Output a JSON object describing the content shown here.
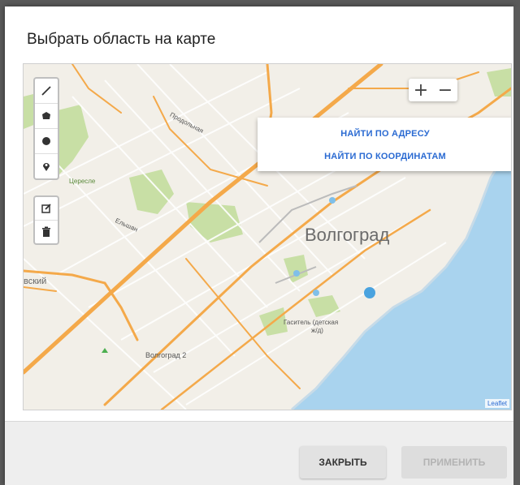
{
  "dialog": {
    "title": "Выбрать область на карте"
  },
  "map": {
    "city_label": "Волгоград",
    "labels": {
      "prodolnaya": "Продольная",
      "elshan": "Ельшан",
      "zelenyi": "Цересле",
      "volgograd2": "Волгоград 2",
      "gasitel": "Гаситель (детская",
      "gasitel2": "ж/д)",
      "vskiy": "вский"
    },
    "attribution": "Leaflet",
    "zoom": {
      "in": "+",
      "out": "−"
    },
    "draw_tools": [
      "polyline-icon",
      "polygon-icon",
      "circle-icon",
      "marker-icon"
    ],
    "edit_tools": [
      "edit-icon",
      "delete-icon"
    ],
    "colors": {
      "water": "#a9d3ee",
      "land": "#f2efe8",
      "park": "#c8dfa5",
      "road": "#f4a94a"
    }
  },
  "search_panel": {
    "find_by_address": "НАЙТИ ПО АДРЕСУ",
    "find_by_coordinates": "НАЙТИ ПО КООРДИНАТАМ"
  },
  "footer": {
    "close_label": "ЗАКРЫТЬ",
    "apply_label": "ПРИМЕНИТЬ"
  }
}
